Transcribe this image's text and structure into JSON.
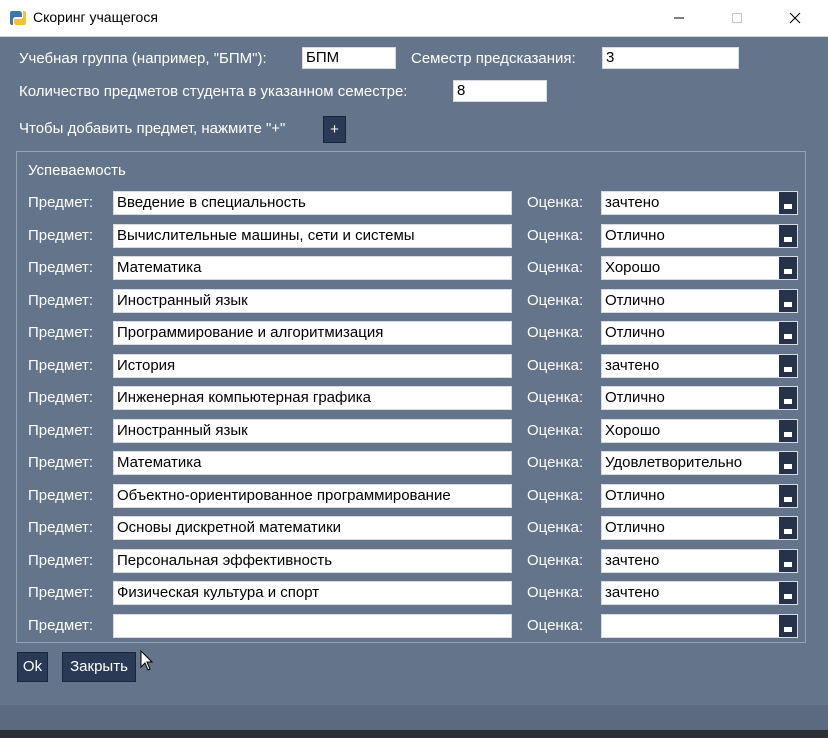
{
  "window": {
    "title": "Скоринг учащегося"
  },
  "form": {
    "group_label": "Учебная группа (например, \"БПМ\"):",
    "group_value": "БПМ",
    "semester_label": "Семестр предсказания:",
    "semester_value": "3",
    "count_label": "Количество предметов студента в указанном семестре:",
    "count_value": "8",
    "add_hint": "Чтобы добавить предмет, нажмите \"+\"",
    "add_button": "+"
  },
  "grades": {
    "frame_title": "Успеваемость",
    "subject_label": "Предмет:",
    "grade_label": "Оценка:",
    "rows": [
      {
        "subject": "Введение в специальность",
        "grade": "зачтено"
      },
      {
        "subject": "Вычислительные машины, сети и системы",
        "grade": "Отлично"
      },
      {
        "subject": "Математика",
        "grade": "Хорошо"
      },
      {
        "subject": "Иностранный язык",
        "grade": "Отлично"
      },
      {
        "subject": "Программирование и алгоритмизация",
        "grade": "Отлично"
      },
      {
        "subject": "История",
        "grade": "зачтено"
      },
      {
        "subject": "Инженерная компьютерная графика",
        "grade": "Отлично"
      },
      {
        "subject": "Иностранный язык",
        "grade": "Хорошо"
      },
      {
        "subject": "Математика",
        "grade": "Удовлетворительно"
      },
      {
        "subject": "Объектно-ориентированное программирование",
        "grade": "Отлично"
      },
      {
        "subject": "Основы дискретной математики",
        "grade": "Отлично"
      },
      {
        "subject": "Персональная эффективность",
        "grade": "зачтено"
      },
      {
        "subject": "Физическая культура и спорт",
        "grade": "зачтено"
      },
      {
        "subject": "",
        "grade": ""
      }
    ]
  },
  "buttons": {
    "ok": "Ok",
    "close": "Закрыть"
  },
  "icons": {
    "app": "app-icon",
    "minimize": "minimize-icon",
    "maximize": "maximize-icon",
    "close": "close-icon",
    "dropdown": "chevron-down-icon",
    "cursor": "mouse-cursor-icon"
  },
  "colors": {
    "background": "#64748a",
    "button": "#2a3a56",
    "dropdown_arrow": "#26314a"
  }
}
